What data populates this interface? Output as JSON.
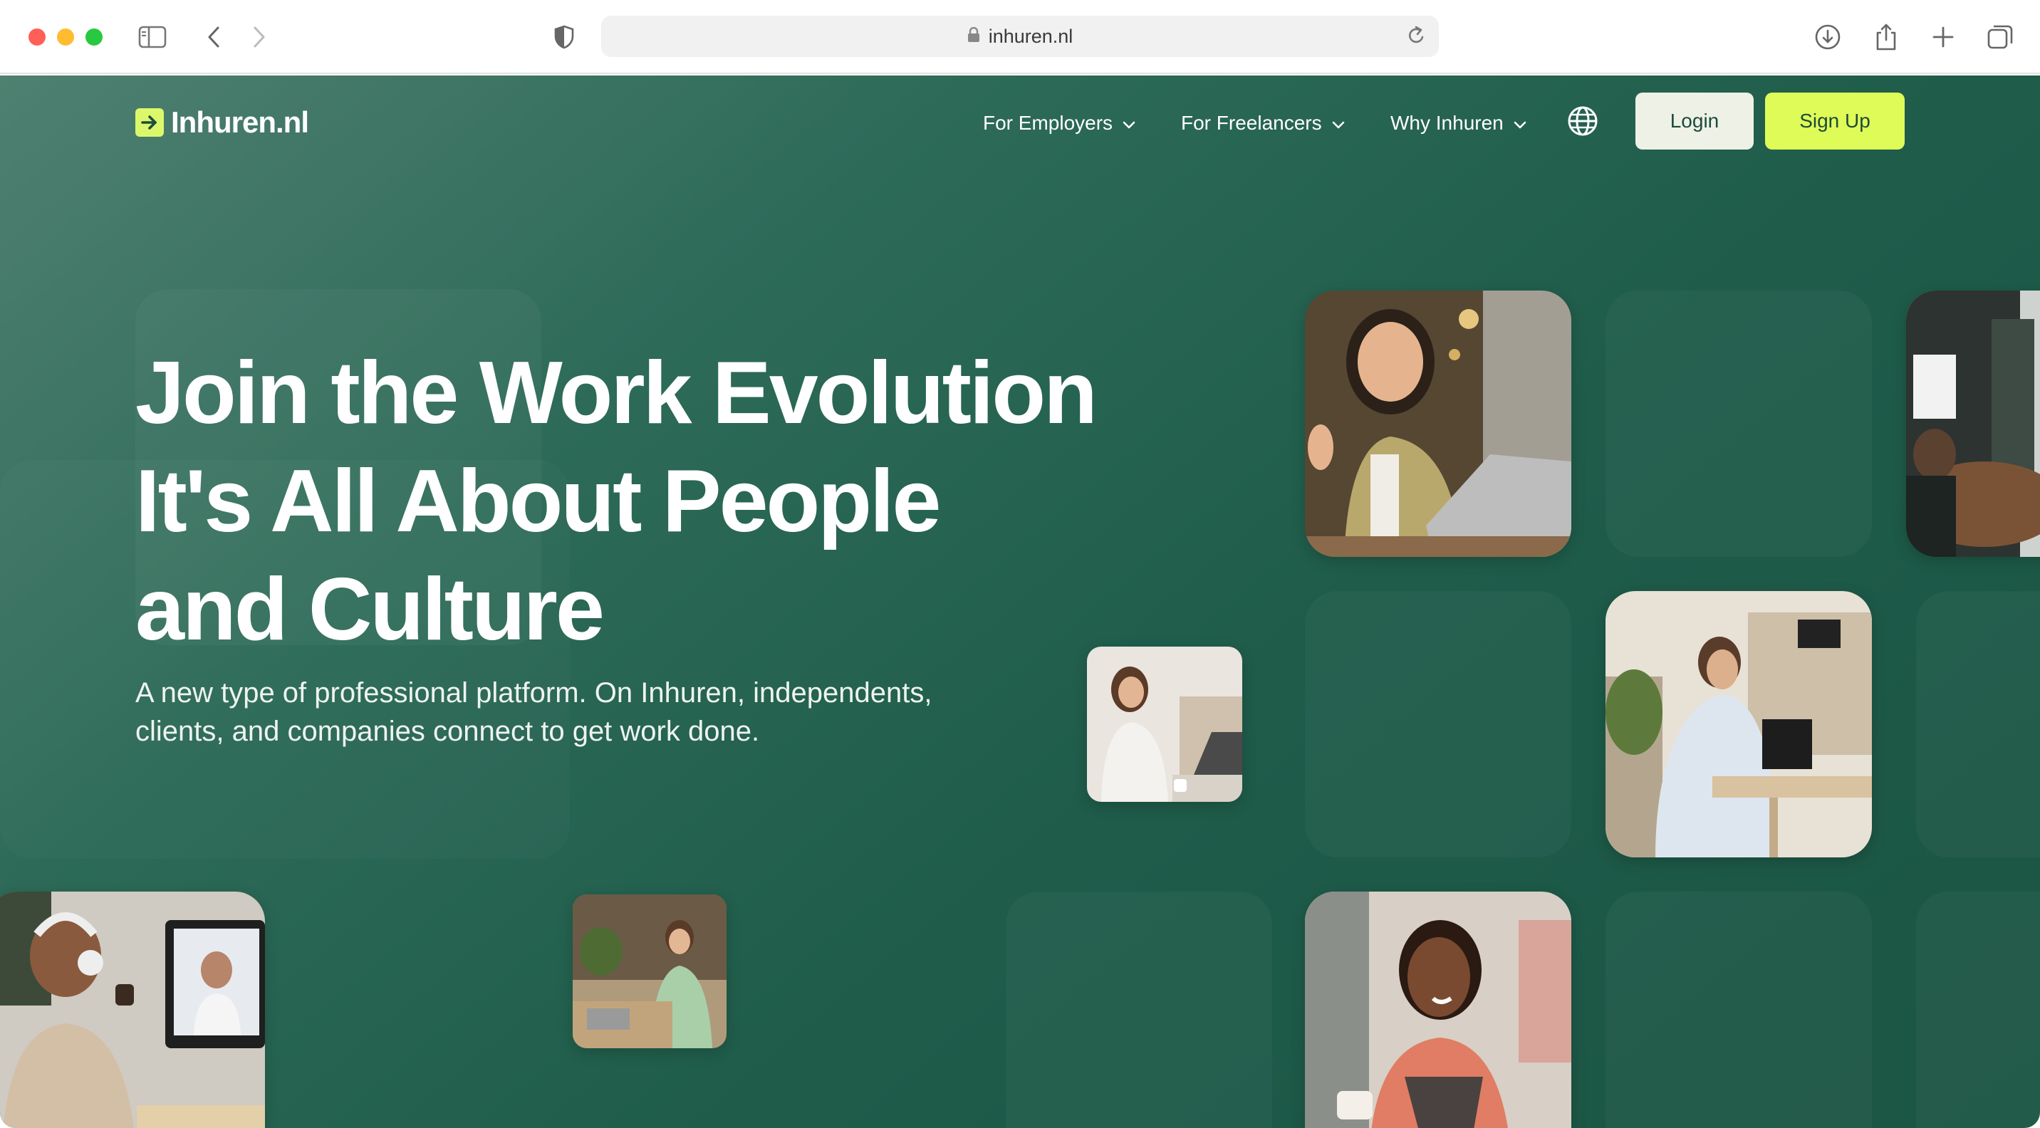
{
  "browser": {
    "url": "inhuren.nl",
    "icons": {
      "sidebar": "sidebar-toggle-icon",
      "back": "chevron-left-icon",
      "forward": "chevron-right-icon",
      "shield": "privacy-shield-icon",
      "lock": "lock-icon",
      "reload": "reload-icon",
      "download": "download-icon",
      "share": "share-icon",
      "new_tab": "plus-icon",
      "tabs": "tab-overview-icon"
    }
  },
  "site": {
    "logo_text": "Inhuren.nl",
    "nav": {
      "employers": "For Employers",
      "freelancers": "For Freelancers",
      "why": "Why Inhuren",
      "language_icon": "globe-icon"
    },
    "login": "Login",
    "signup": "Sign Up"
  },
  "hero": {
    "title_line1": "Join the Work Evolution",
    "title_line2": "It's All About People",
    "title_line3": "and Culture",
    "subtitle_line1": "A new type of professional platform. On Inhuren, independents,",
    "subtitle_line2": "clients, and companies connect to get work done."
  },
  "colors": {
    "background": "#1f5c4a",
    "accent": "#dffb57",
    "login_bg": "#eef1e6",
    "text": "#ffffff"
  }
}
